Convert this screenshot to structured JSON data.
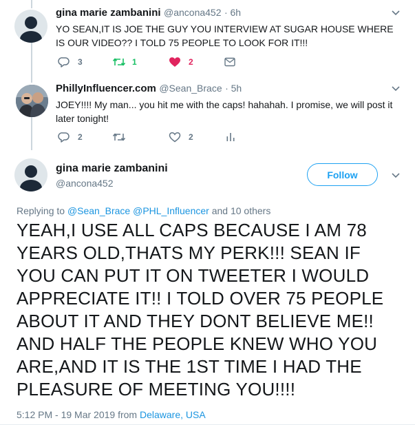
{
  "tweet1": {
    "name": "gina marie zambanini",
    "handle": "@ancona452",
    "time": "· 6h",
    "text": "YO SEAN,IT IS JOE THE GUY YOU INTERVIEW AT SUGAR HOUSE WHERE IS OUR VIDEO?? I TOLD 75 PEOPLE TO LOOK FOR IT!!!",
    "reply_count": "3",
    "retweet_count": "1",
    "like_count": "2",
    "like_color": "#e0245e",
    "retweet_color": "#17bf63"
  },
  "tweet2": {
    "name": "PhillyInfluencer.com",
    "handle": "@Sean_Brace",
    "time": "· 5h",
    "text": "JOEY!!!! My man... you hit me with the caps! hahahah. I promise, we will post it later tonight!",
    "reply_count": "2",
    "like_count": "2"
  },
  "main": {
    "name": "gina marie zambanini",
    "handle": "@ancona452",
    "follow_label": "Follow",
    "replying_prefix": "Replying to",
    "replying_user1": "@Sean_Brace",
    "replying_user2": "@PHL_Influencer",
    "replying_suffix": "and 10 others",
    "text": "YEAH,I USE ALL CAPS BECAUSE I AM 78 YEARS OLD,THATS MY PERK!!! SEAN IF YOU CAN PUT IT ON TWEETER I WOULD APPRECIATE IT!! I TOLD OVER 75 PEOPLE ABOUT IT AND THEY DONT BELIEVE ME!! AND HALF THE PEOPLE KNEW WHO YOU ARE,AND IT IS THE 1ST TIME I HAD THE PLEASURE OF MEETING YOU!!!!",
    "timestamp": "5:12 PM - 19 Mar 2019 from",
    "location": "Delaware, USA"
  },
  "colors": {
    "accent": "#1da1f2",
    "link": "#1b95e0",
    "secondary_text": "#657786"
  }
}
